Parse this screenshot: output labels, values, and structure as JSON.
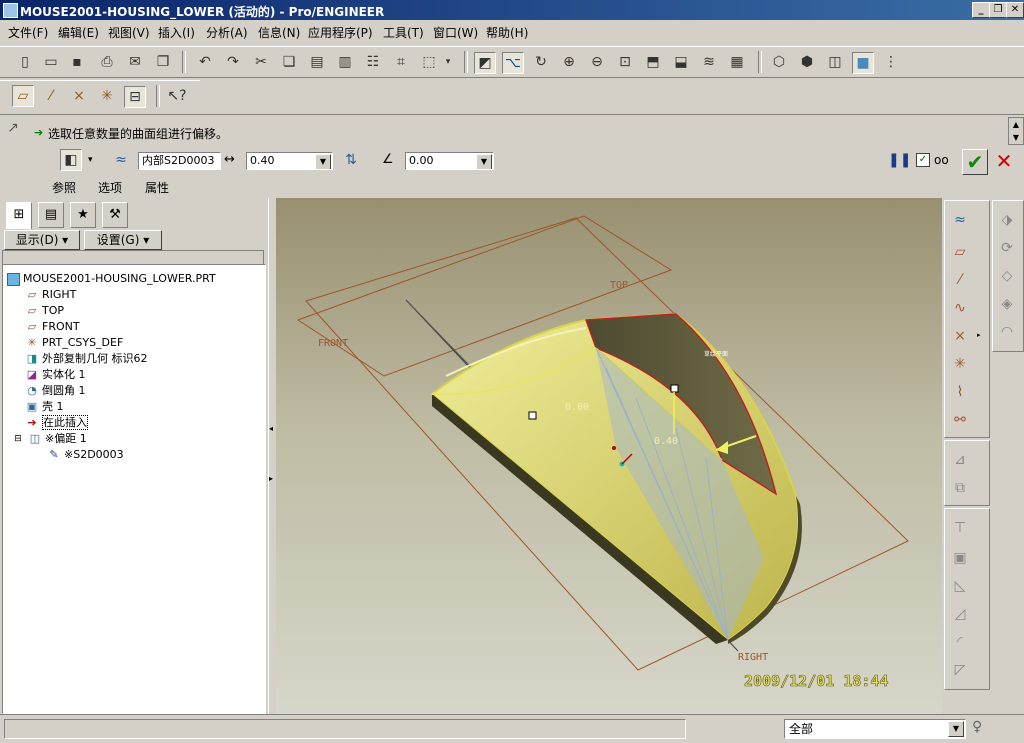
{
  "window": {
    "title": "MOUSE2001-HOUSING_LOWER (活动的) - Pro/ENGINEER",
    "minimize": "_",
    "restore": "❐",
    "close": "✕"
  },
  "menu": {
    "items": [
      "文件(F)",
      "编辑(E)",
      "视图(V)",
      "插入(I)",
      "分析(A)",
      "信息(N)",
      "应用程序(P)",
      "工具(T)",
      "窗口(W)",
      "帮助(H)"
    ]
  },
  "toolbar": {
    "main_icons": [
      "new-icon",
      "open-icon",
      "save-icon",
      "print-icon",
      "send-icon",
      "copy-icon",
      "paste-icon",
      "undo-icon",
      "redo-icon",
      "cut-icon",
      "copy2-icon",
      "paste2-icon",
      "paste-special-icon",
      "regenerate-icon",
      "find-icon",
      "select-box-icon",
      "dropdown-icon",
      "repaint-icon",
      "spin-center-icon",
      "orient-icon",
      "zoom-in-icon",
      "zoom-out-icon",
      "refit-icon",
      "view-manager-icon",
      "saved-views-icon",
      "layers-icon",
      "appearance-icon",
      "wireframe-icon",
      "hidden-line-icon",
      "no-hidden-icon",
      "shading-icon",
      "model-tree-icon"
    ],
    "datum_icons": [
      "datum-plane-display-icon",
      "datum-axis-display-icon",
      "point-display-icon",
      "csys-display-icon",
      "annotation-display-icon",
      "context-help-icon"
    ]
  },
  "dashboard": {
    "prompt": "选取任意数量的曲面组进行偏移。",
    "surface_ref": "内部S2D0003",
    "offset_value": "0.40",
    "angle_value": "0.00",
    "tabs": [
      "参照",
      "选项",
      "属性"
    ]
  },
  "model_tree": {
    "show_button": "显示(D) ▾",
    "settings_button": "设置(G) ▾",
    "items": [
      {
        "label": "MOUSE2001-HOUSING_LOWER.PRT",
        "icon": "part-icon",
        "level": 0
      },
      {
        "label": "RIGHT",
        "icon": "datum-plane-icon",
        "level": 1
      },
      {
        "label": "TOP",
        "icon": "datum-plane-icon",
        "level": 1
      },
      {
        "label": "FRONT",
        "icon": "datum-plane-icon",
        "level": 1
      },
      {
        "label": "PRT_CSYS_DEF",
        "icon": "csys-icon",
        "level": 1
      },
      {
        "label": "外部复制几何 标识62",
        "icon": "copy-geom-icon",
        "level": 1
      },
      {
        "label": "实体化 1",
        "icon": "solidify-icon",
        "level": 1
      },
      {
        "label": "倒圆角 1",
        "icon": "round-icon",
        "level": 1
      },
      {
        "label": "壳 1",
        "icon": "shell-icon",
        "level": 1
      },
      {
        "label": "在此插入",
        "icon": "insert-here-icon",
        "level": 1
      },
      {
        "label": "※偏距 1",
        "icon": "offset-icon",
        "level": 1
      },
      {
        "label": "※S2D0003",
        "icon": "sketch-icon",
        "level": 2
      }
    ]
  },
  "graphics": {
    "labels": {
      "top": "TOP",
      "front": "FRONT",
      "right": "RIGHT"
    },
    "dim1": "0.00",
    "dim2": "0.40",
    "small_note": "草绘平面",
    "timestamp": "2009/12/01  18:44"
  },
  "status": {
    "filter": "全部"
  }
}
